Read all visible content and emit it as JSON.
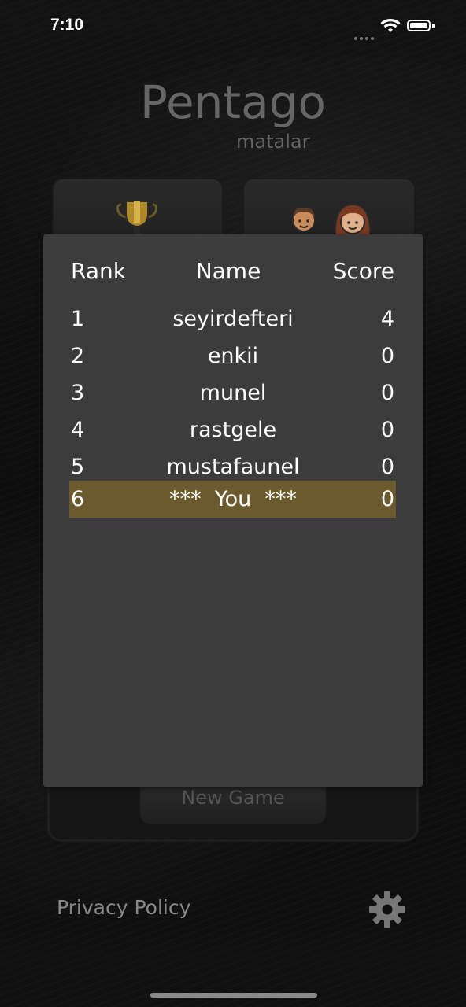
{
  "status_bar": {
    "time": "7:10"
  },
  "app": {
    "title": "Pentago",
    "subtitle": "matalar"
  },
  "main": {
    "new_game_label": "New Game"
  },
  "leaderboard": {
    "headers": {
      "rank": "Rank",
      "name": "Name",
      "score": "Score"
    },
    "rows": [
      {
        "rank": "1",
        "name": "seyirdefteri",
        "score": "4"
      },
      {
        "rank": "2",
        "name": "enkii",
        "score": "0"
      },
      {
        "rank": "3",
        "name": "munel",
        "score": "0"
      },
      {
        "rank": "4",
        "name": "rastgele",
        "score": "0"
      },
      {
        "rank": "5",
        "name": "mustafaunel",
        "score": "0"
      },
      {
        "rank": "6",
        "name": "***  You  ***",
        "score": "0"
      }
    ],
    "highlight_color": "#6b5a2e"
  },
  "footer": {
    "privacy_label": "Privacy Policy"
  },
  "icons": [
    "trophy-icon",
    "people-icon",
    "gear-icon",
    "wifi-icon",
    "battery-icon"
  ]
}
